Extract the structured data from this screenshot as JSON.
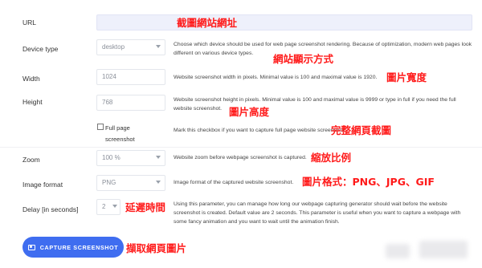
{
  "fields": {
    "url": {
      "label": "URL",
      "value": "",
      "annotation": "截圖網站網址"
    },
    "device_type": {
      "label": "Device type",
      "value": "desktop",
      "description": "Choose which device should be used for web page screenshot rendering. Because of optimization, modern web pages look different on various device types.",
      "annotation": "網站顯示方式"
    },
    "width": {
      "label": "Width",
      "value": "1024",
      "description": "Website screenshot width in pixels. Minimal value is 100 and maximal value is 1920.",
      "annotation": "圖片寬度"
    },
    "height": {
      "label": "Height",
      "value": "768",
      "description": "Website screenshot height in pixels. Minimal value is 100 and maximal value is 9999 or type in full if you need the full website screenshot.",
      "annotation": "圖片高度"
    },
    "full_page": {
      "label": "Full page screenshot",
      "checked": false,
      "description": "Mark this checkbox if you want to capture full page website screenshot.",
      "annotation": "完整網頁截圖"
    },
    "zoom": {
      "label": "Zoom",
      "value": "100 %",
      "description": "Website zoom before webpage screenshot is captured.",
      "annotation": "縮放比例"
    },
    "image_format": {
      "label": "Image format",
      "value": "PNG",
      "description": "Image format of the captured website screenshot.",
      "annotation": "圖片格式：PNG、JPG、GIF"
    },
    "delay": {
      "label": "Delay [in seconds]",
      "value": "2",
      "description": "Using this parameter, you can manage how long our webpage capturing generator should wait before the website screenshot is created. Default value are 2 seconds. This parameter is useful when you want to capture a webpage with some fancy animation and you want to wait until the animation finish.",
      "annotation": "延遲時間"
    }
  },
  "capture_button": {
    "label": "CAPTURE SCREENSHOT",
    "icon": "camera-icon",
    "annotation": "擷取網頁圖片"
  },
  "colors": {
    "accent": "#3f6df0",
    "annotation": "#ff1a1a"
  }
}
